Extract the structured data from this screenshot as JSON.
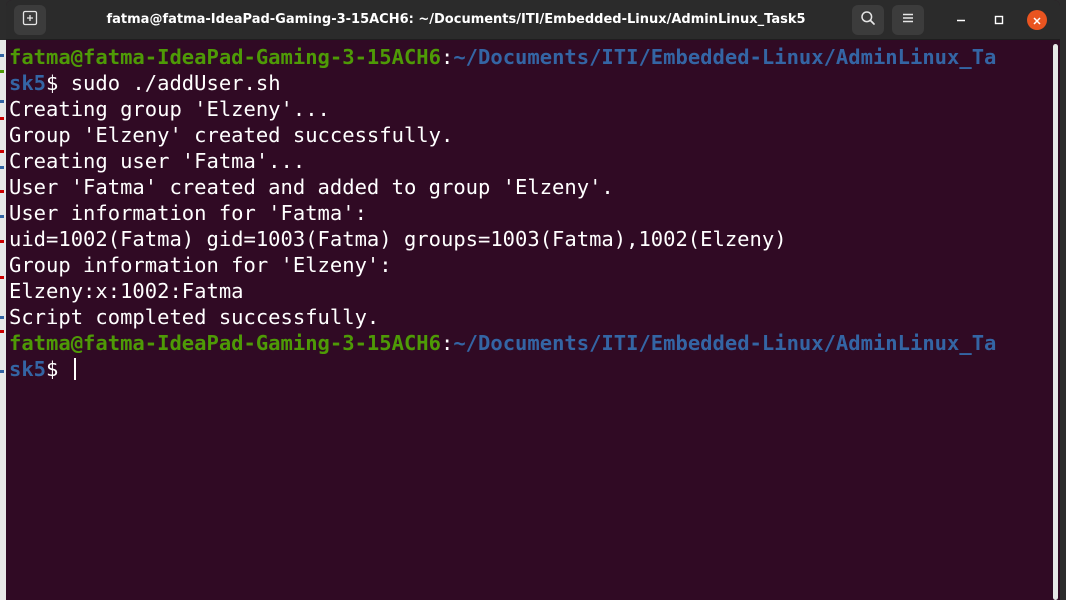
{
  "window": {
    "title": "fatma@fatma-IdeaPad-Gaming-3-15ACH6: ~/Documents/ITI/Embedded-Linux/AdminLinux_Task5"
  },
  "terminal": {
    "prompt1": {
      "user": "fatma@fatma-IdeaPad-Gaming-3-15ACH6",
      "sep": ":",
      "path_part1": "~/Documents/ITI/Embedded-Linux/AdminLinux_Ta",
      "path_part2": "sk5",
      "symbol": "$ ",
      "command": "sudo ./addUser.sh"
    },
    "output": [
      "Creating group 'Elzeny'...",
      "Group 'Elzeny' created successfully.",
      "Creating user 'Fatma'...",
      "User 'Fatma' created and added to group 'Elzeny'.",
      "User information for 'Fatma':",
      "uid=1002(Fatma) gid=1003(Fatma) groups=1003(Fatma),1002(Elzeny)",
      "Group information for 'Elzeny':",
      "Elzeny:x:1002:Fatma",
      "Script completed successfully."
    ],
    "prompt2": {
      "user": "fatma@fatma-IdeaPad-Gaming-3-15ACH6",
      "sep": ":",
      "path_part1": "~/Documents/ITI/Embedded-Linux/AdminLinux_Ta",
      "path_part2": "sk5",
      "symbol": "$ "
    }
  },
  "colors": {
    "background": "#300a24",
    "user": "#4e9a06",
    "path": "#3465a4",
    "text": "#ffffff",
    "titlebar": "#2b2b2b",
    "close": "#e95420"
  },
  "icons": {
    "new_tab": "new-tab-icon",
    "search": "search-icon",
    "menu": "hamburger-menu-icon",
    "minimize": "minimize-icon",
    "maximize": "maximize-icon",
    "close": "close-icon"
  }
}
